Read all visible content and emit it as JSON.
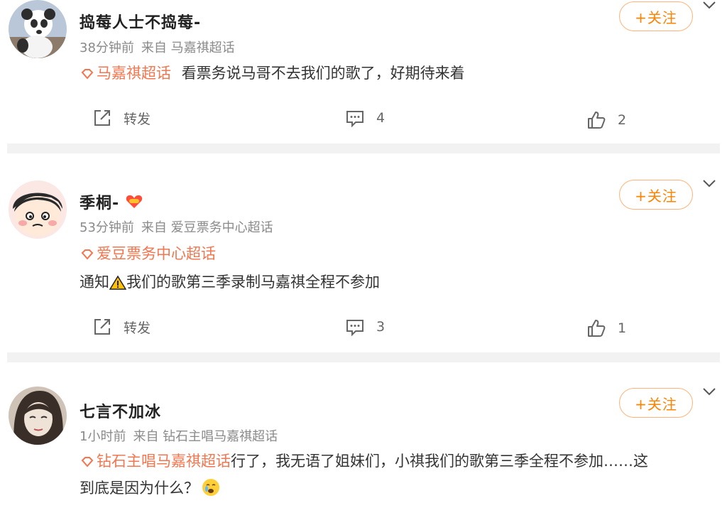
{
  "colors": {
    "accent": "#ff8200",
    "topic": "#f2764f",
    "meta": "#8a8a8a",
    "separator": "#f2f2f2"
  },
  "posts": [
    {
      "username": "捣莓人士不捣莓-",
      "time": "38分钟前",
      "source": "来自 马嘉祺超话",
      "follow_label": "+关注",
      "topic": "马嘉祺超话",
      "text": "看票务说马哥不去我们的歌了，好期待来着",
      "repost_label": "转发",
      "comment_count": "4",
      "like_count": "2"
    },
    {
      "username": "季桐-",
      "time": "53分钟前",
      "source": "来自 爱豆票务中心超话",
      "follow_label": "+关注",
      "topic": "爱豆票务中心超话",
      "text_prefix": "通知",
      "text": "我们的歌第三季录制马嘉祺全程不参加",
      "repost_label": "转发",
      "comment_count": "3",
      "like_count": "1"
    },
    {
      "username": "七言不加冰",
      "time": "1小时前",
      "source": "来自 钻石主唱马嘉祺超话",
      "follow_label": "+关注",
      "topic": "钻石主唱马嘉祺超话",
      "text_line1": "行了，我无语了姐妹们，小祺我们的歌第三季全程不参加……这",
      "text_line2": "到底是因为什么？"
    }
  ]
}
